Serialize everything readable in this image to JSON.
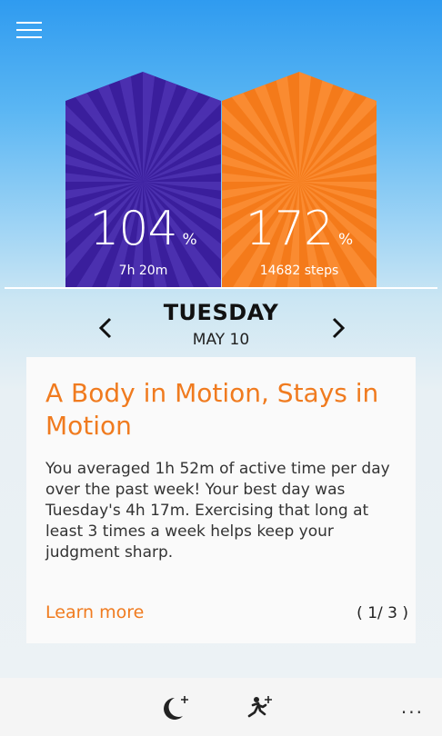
{
  "menu_icon": "hamburger-menu-icon",
  "sleep": {
    "percent": "104",
    "percent_symbol": "%",
    "detail": "7h 20m",
    "color": "#3a1e9c"
  },
  "steps": {
    "percent": "172",
    "percent_symbol": "%",
    "detail": "14682 steps",
    "color": "#f47a1a"
  },
  "date_nav": {
    "day": "TUESDAY",
    "date": "MAY 10",
    "prev_icon": "chevron-left-icon",
    "next_icon": "chevron-right-icon"
  },
  "insight_card": {
    "title": "A Body in Motion, Stays in Motion",
    "body": "You averaged 1h 52m of active time per day over the past week! Your best day was Tuesday's 4h 17m. Exercising that long at least 3 times a week helps keep your judgment sharp.",
    "link": "Learn more",
    "pager": "( 1/ 3 )",
    "accent_color": "#f07b1f"
  },
  "app_bar": {
    "buttons": [
      {
        "icon": "add-sleep-icon"
      },
      {
        "icon": "add-activity-icon"
      }
    ],
    "more_label": "..."
  }
}
